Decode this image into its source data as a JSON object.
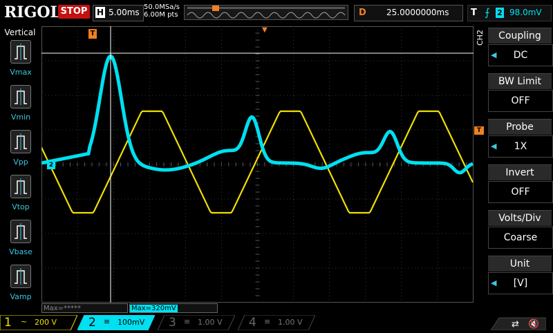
{
  "header": {
    "brand": "RIGOL",
    "run_state": "STOP",
    "horizontal_letter": "H",
    "timebase": "5.00ms",
    "sample_rate": "50.0MSa/s",
    "memory_depth": "6.00M pts",
    "delay_letter": "D",
    "delay": "25.0000000ms",
    "trigger_letter": "T",
    "trigger_channel": "2",
    "trigger_level": "98.0mV"
  },
  "left_panel": {
    "title": "Vertical",
    "items": [
      {
        "label": "Vmax"
      },
      {
        "label": "Vmin"
      },
      {
        "label": "Vpp"
      },
      {
        "label": "Vtop"
      },
      {
        "label": "Vbase"
      },
      {
        "label": "Vamp"
      }
    ]
  },
  "menu": {
    "channel": "CH2",
    "items": [
      {
        "title": "Coupling",
        "value": "DC"
      },
      {
        "title": "BW Limit",
        "value": "OFF"
      },
      {
        "title": "Probe",
        "value": "1X"
      },
      {
        "title": "Invert",
        "value": "OFF"
      },
      {
        "title": "Volts/Div",
        "value": "Coarse"
      },
      {
        "title": "Unit",
        "value": "[V]"
      }
    ]
  },
  "measurements": {
    "m1": "Max=*****",
    "m2": "Max=320mV"
  },
  "markers": {
    "trigger_pos": "T",
    "ch2_ref": "2",
    "trig_level": "T"
  },
  "channels": [
    {
      "num": "1",
      "coupling": "~",
      "scale": "200 V",
      "color": "#f0e000"
    },
    {
      "num": "2",
      "coupling": "≡",
      "scale": "100mV",
      "color": "#00e0f0"
    },
    {
      "num": "3",
      "coupling": "≡",
      "scale": "1.00 V",
      "color": "#c020c0"
    },
    {
      "num": "4",
      "coupling": "≡",
      "scale": "1.00 V",
      "color": "#2060e0"
    }
  ],
  "colors": {
    "ch1": "#f0e000",
    "ch2": "#00e0f0",
    "stop": "#c41010",
    "accent": "#f08020",
    "grid": "#3a3a3a"
  }
}
